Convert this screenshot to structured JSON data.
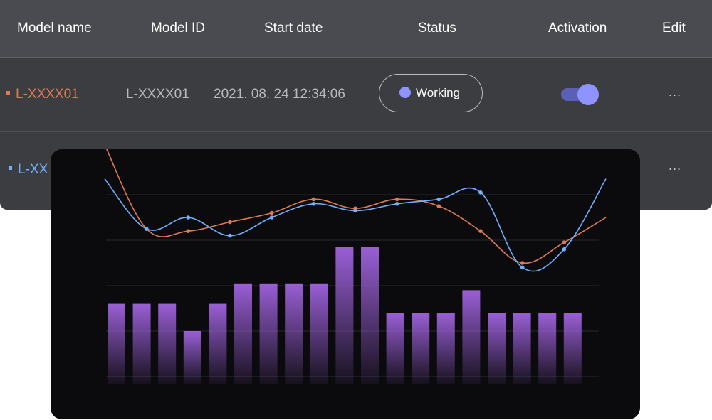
{
  "table": {
    "headers": {
      "model_name": "Model name",
      "model_id": "Model ID",
      "start_date": "Start date",
      "status": "Status",
      "activation": "Activation",
      "edit": "Edit"
    },
    "rows": [
      {
        "name": "L-XXXX01",
        "name_color": "#e07a52",
        "model_id": "L-XXXX01",
        "start_date": "2021. 08. 24 12:34:06",
        "status": "Working",
        "activation": true,
        "edit": "..."
      },
      {
        "name": "L-XX",
        "name_color": "#6fb0ff",
        "edit": "..."
      }
    ]
  },
  "colors": {
    "status_dot": "#8e93ff",
    "toggle_on": "#8e93ff",
    "line_orange": "#e07a52",
    "line_blue": "#6fb0ff",
    "bar_purple": "#9a5fd6"
  },
  "chart_data": {
    "type": "bar",
    "grid": true,
    "ylim": [
      0,
      10
    ],
    "bars": [
      3.2,
      3.2,
      3.2,
      2.0,
      3.2,
      4.1,
      4.1,
      4.1,
      4.1,
      5.7,
      5.7,
      2.8,
      2.8,
      2.8,
      3.8,
      2.8,
      2.8,
      2.8,
      2.8
    ],
    "series": [
      {
        "color": "#e07a52",
        "values": [
          10.2,
          6.5,
          6.4,
          6.8,
          7.2,
          7.8,
          7.4,
          7.8,
          7.5,
          6.4,
          5.0,
          5.9,
          7.0
        ]
      },
      {
        "color": "#6fb0ff",
        "values": [
          8.7,
          6.5,
          7.0,
          6.2,
          7.0,
          7.6,
          7.3,
          7.6,
          7.8,
          8.1,
          4.8,
          5.6,
          8.7
        ]
      }
    ]
  }
}
